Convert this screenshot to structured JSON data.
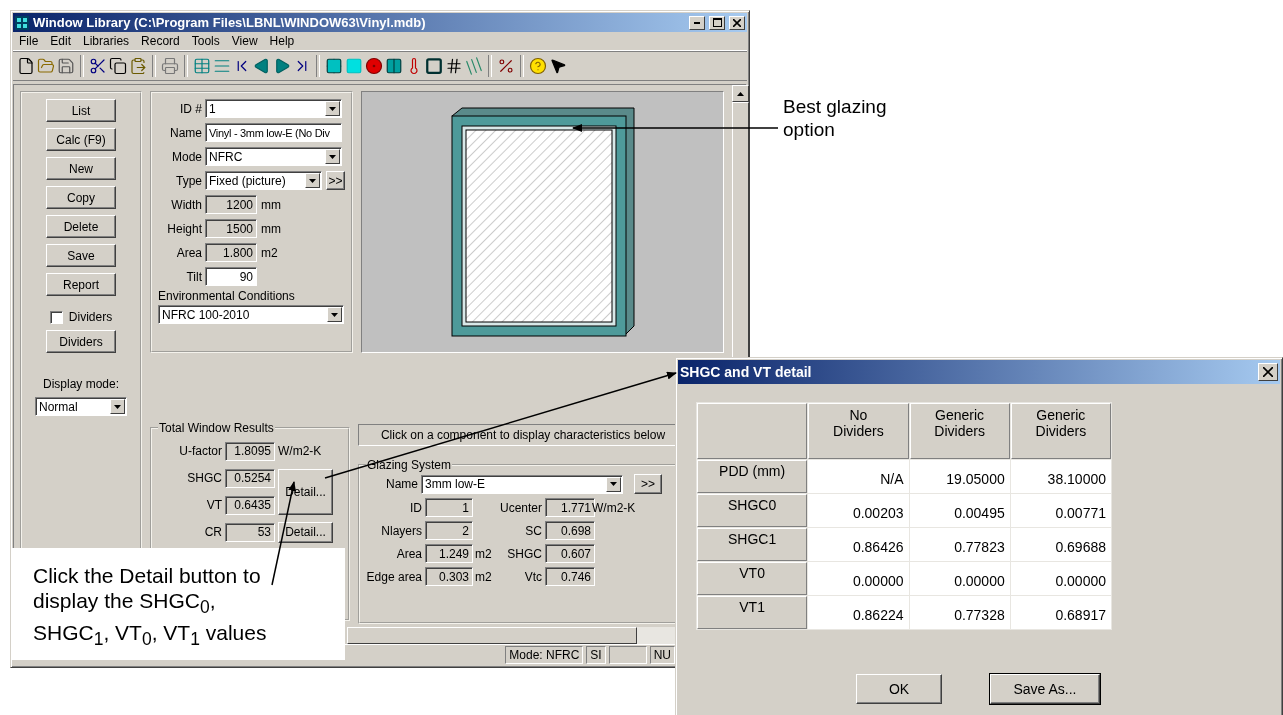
{
  "window": {
    "title": "Window Library (C:\\Program Files\\LBNL\\WINDOW63\\Vinyl.mdb)"
  },
  "menu": [
    "File",
    "Edit",
    "Libraries",
    "Record",
    "Tools",
    "View",
    "Help"
  ],
  "side_buttons": [
    "List",
    "Calc (F9)",
    "New",
    "Copy",
    "Delete",
    "Save",
    "Report"
  ],
  "dividers_checkbox": {
    "label": "Dividers",
    "checked": false
  },
  "dividers_button": "Dividers",
  "display_mode": {
    "label": "Display mode:",
    "value": "Normal"
  },
  "record_fields": [
    {
      "label": "ID #",
      "value": "1",
      "kind": "combo"
    },
    {
      "label": "Name",
      "value": "Vinyl - 3mm low-E (No Div",
      "kind": "text"
    },
    {
      "label": "Mode",
      "value": "NFRC",
      "kind": "combo"
    },
    {
      "label": "Type",
      "value": "Fixed (picture)",
      "kind": "combo_more",
      "more": ">>"
    },
    {
      "label": "Width",
      "value": "1200",
      "unit": "mm",
      "kind": "readonly"
    },
    {
      "label": "Height",
      "value": "1500",
      "unit": "mm",
      "kind": "readonly"
    },
    {
      "label": "Area",
      "value": "1.800",
      "unit": "m2",
      "kind": "readonly"
    },
    {
      "label": "Tilt",
      "value": "90",
      "kind": "number"
    }
  ],
  "environment": {
    "label": "Environmental Conditions",
    "value": "NFRC 100-2010"
  },
  "results": {
    "title": "Total Window Results",
    "rows": [
      {
        "label": "U-factor",
        "value": "1.8095",
        "unit": "W/m2-K"
      },
      {
        "label": "SHGC",
        "value": "0.5254"
      },
      {
        "label": "VT",
        "value": "0.6435"
      },
      {
        "label": "CR",
        "value": "53"
      }
    ],
    "buttons": [
      "Detail...",
      "Detail..."
    ]
  },
  "hint": "Click on a component to display characteristics below",
  "glazing": {
    "title": "Glazing System",
    "name": {
      "label": "Name",
      "value": "3mm low-E",
      "more": ">>"
    },
    "left": [
      {
        "label": "ID",
        "value": "1"
      },
      {
        "label": "Nlayers",
        "value": "2"
      },
      {
        "label": "Area",
        "value": "1.249",
        "unit": "m2"
      },
      {
        "label": "Edge area",
        "value": "0.303",
        "unit": "m2"
      }
    ],
    "right": [
      {
        "label": "Ucenter",
        "value": "1.771",
        "unit": "W/m2-K"
      },
      {
        "label": "SC",
        "value": "0.698"
      },
      {
        "label": "SHGC",
        "value": "0.607"
      },
      {
        "label": "Vtc",
        "value": "0.746"
      }
    ]
  },
  "status_bar": [
    "Mode: NFRC",
    "SI",
    "NU"
  ],
  "dialog": {
    "title": "SHGC and VT detail",
    "columns": [
      "No Dividers",
      "Generic Dividers",
      "Generic Dividers"
    ],
    "rows": [
      {
        "label": "PDD (mm)",
        "values": [
          "N/A",
          "19.05000",
          "38.10000"
        ]
      },
      {
        "label": "SHGC0",
        "values": [
          "0.00203",
          "0.00495",
          "0.00771"
        ]
      },
      {
        "label": "SHGC1",
        "values": [
          "0.86426",
          "0.77823",
          "0.69688"
        ]
      },
      {
        "label": "VT0",
        "values": [
          "0.00000",
          "0.00000",
          "0.00000"
        ]
      },
      {
        "label": "VT1",
        "values": [
          "0.86224",
          "0.77328",
          "0.68917"
        ]
      }
    ],
    "buttons": [
      {
        "label": "OK",
        "default": false
      },
      {
        "label": "Save As...",
        "default": true
      }
    ]
  },
  "annotations": [
    "Best glazing option",
    "Click the Detail button to display the SHGC$_{0}$, SHGC$_{1}$, VT$_{0}$, VT$_{1}$ values"
  ]
}
